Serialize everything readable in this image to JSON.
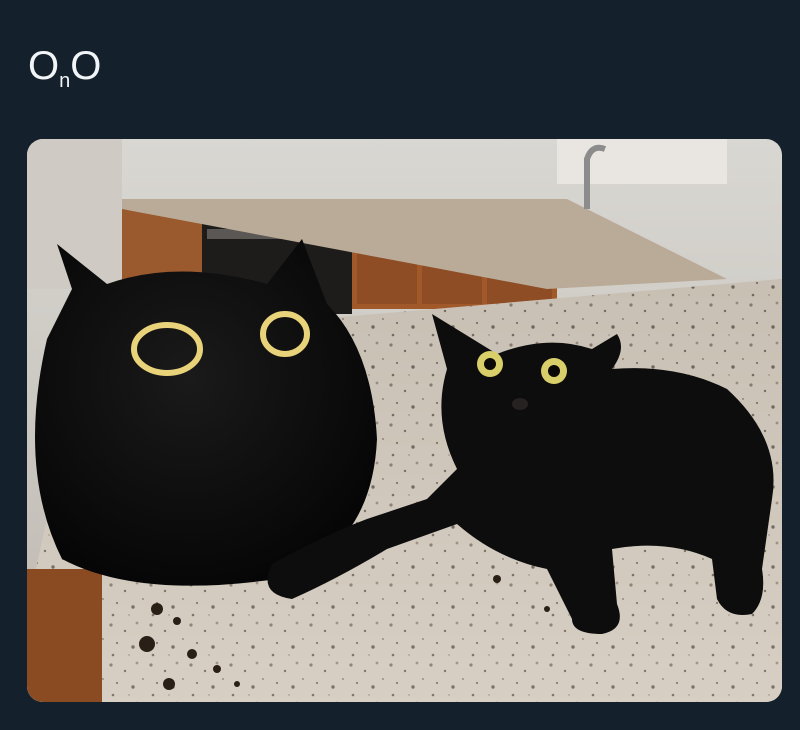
{
  "post": {
    "text_main_a": "O",
    "text_sub": "n",
    "text_main_b": "O"
  },
  "media": {
    "subjects": [
      "cat-plush",
      "black-cat",
      "kitchen-counter"
    ]
  },
  "colors": {
    "background": "#14202b",
    "text": "#f2f5f7",
    "eye_ring": "#e8d27a",
    "cat_eye": "#d9cf6a"
  }
}
